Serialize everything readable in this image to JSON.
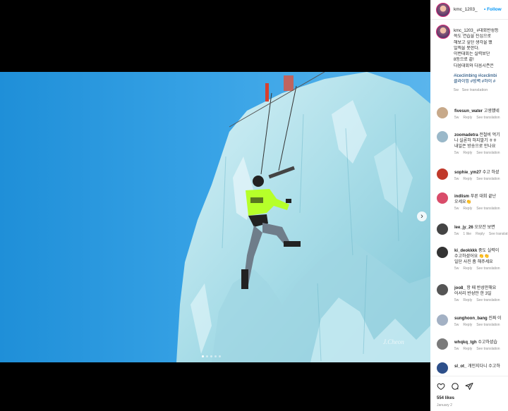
{
  "post": {
    "author": "kmc_1203_",
    "follow_label": "• Follow",
    "caption_lines": [
      "kmc_1203_ #대회반성등",
      "쓱도 연습을 진심으로",
      "해보고 싶단 생각을 했",
      "일찍을 못한다.",
      "이번대회는 실력보단 ",
      "8등으로 끝!",
      "다음대회와 다음시즌은"
    ],
    "hashtags": [
      "#iceclimbing #iceclimbi",
      "클라이밍 #빙벽 #하이 #"
    ],
    "caption_time": "5w",
    "see_translation": "See translation",
    "photo_signature": "J.Cheon",
    "carousel_dots": 5,
    "active_dot": 1
  },
  "comments": [
    {
      "user": "fivesun_water",
      "text": "고생했네",
      "extra": "",
      "time": "5w",
      "reply": "Reply",
      "likes": "",
      "translate": "See translation",
      "avatar_color": "#c7a98a"
    },
    {
      "user": "zoomadetra",
      "text": "전철비 먹기",
      "extra": [
        "나 실론하 하지말기 ㅎㅎ",
        "내일은 방송으로 만나요"
      ],
      "time": "5w",
      "reply": "Reply",
      "likes": "",
      "translate": "See translation",
      "avatar_color": "#9ab8c9"
    },
    {
      "user": "sophie_ym27",
      "text": "수고 하셨",
      "extra": "",
      "time": "5w",
      "reply": "Reply",
      "likes": "",
      "translate": "See translation",
      "avatar_color": "#c0392b"
    },
    {
      "user": "indlism",
      "text": "푸른 대회 끝난",
      "extra": [
        "오세요👏"
      ],
      "time": "5w",
      "reply": "Reply",
      "likes": "",
      "translate": "See translation",
      "avatar_color": "#d94c6a"
    },
    {
      "user": "lee_jy_26",
      "text": "오모잔 보면",
      "extra": "",
      "time": "5w",
      "reply": "Reply",
      "likes": "1 like",
      "translate": "See translation",
      "avatar_color": "#444"
    },
    {
      "user": "ki_deokkkk",
      "text": "중도 실력이",
      "extra": [
        "수고하셨어요 👏👏",
        "일단 사진 좀 해주세요"
      ],
      "time": "5w",
      "reply": "Reply",
      "likes": "",
      "translate": "See translation",
      "avatar_color": "#333"
    },
    {
      "user": "joo8_",
      "text": "항 때 반성만해요",
      "extra": [
        "어서리 반성만 한 3일"
      ],
      "time": "5w",
      "reply": "Reply",
      "likes": "",
      "translate": "See translation",
      "avatar_color": "#555"
    },
    {
      "user": "sunghoon_bang",
      "text": "진짜 이",
      "extra": "",
      "time": "5w",
      "reply": "Reply",
      "likes": "",
      "translate": "See translation",
      "avatar_color": "#a3b1c4"
    },
    {
      "user": "whqkq_tgh",
      "text": "수고하셨습",
      "extra": "",
      "time": "5w",
      "reply": "Reply",
      "likes": "",
      "translate": "See translation",
      "avatar_color": "#7a7a7a"
    },
    {
      "user": "sl_ot_",
      "text": "개인지다니 수고하",
      "extra": "",
      "time": "",
      "reply": "",
      "likes": "",
      "translate": "",
      "avatar_color": "#2d4f8a"
    }
  ],
  "footer": {
    "likes": "554 likes",
    "ago": "January 2"
  },
  "icons": {
    "next": "chevron-right-icon",
    "like": "heart-icon",
    "comment": "comment-icon",
    "share": "share-icon"
  }
}
